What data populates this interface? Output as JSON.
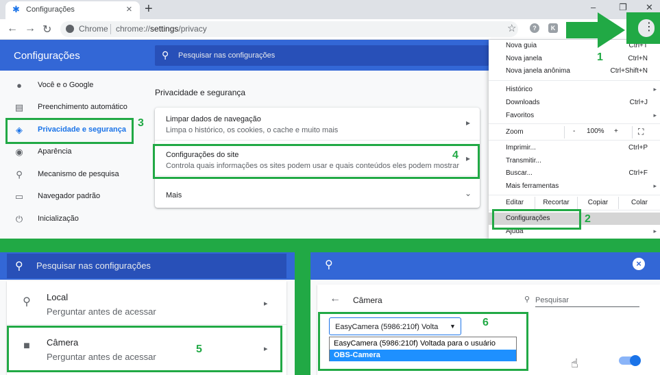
{
  "browser": {
    "tab_title": "Configurações",
    "new_tab": "+",
    "omnibox_scheme": "Chrome",
    "url_prefix": "chrome://",
    "url_host": "settings",
    "url_path": "/privacy",
    "ext_k": "K"
  },
  "settings": {
    "title": "Configurações",
    "search_placeholder": "Pesquisar nas configurações",
    "sidebar": [
      {
        "label": "Você e o Google",
        "icon": "person-icon"
      },
      {
        "label": "Preenchimento automático",
        "icon": "clipboard-icon"
      },
      {
        "label": "Privacidade e segurança",
        "icon": "shield-icon",
        "active": true
      },
      {
        "label": "Aparência",
        "icon": "palette-icon"
      },
      {
        "label": "Mecanismo de pesquisa",
        "icon": "search-icon"
      },
      {
        "label": "Navegador padrão",
        "icon": "browser-icon"
      },
      {
        "label": "Inicialização",
        "icon": "power-icon"
      }
    ],
    "section_title": "Privacidade e segurança",
    "rows": [
      {
        "title": "Limpar dados de navegação",
        "desc": "Limpa o histórico, os cookies, o cache e muito mais"
      },
      {
        "title": "Configurações do site",
        "desc": "Controla quais informações os sites podem usar e quais conteúdos eles podem mostrar"
      },
      {
        "title": "Mais"
      }
    ]
  },
  "menu": {
    "new_tab": {
      "label": "Nova guia",
      "shortcut": "Ctrl+T"
    },
    "new_window": {
      "label": "Nova janela",
      "shortcut": "Ctrl+N"
    },
    "new_incognito": {
      "label": "Nova janela anônima",
      "shortcut": "Ctrl+Shift+N"
    },
    "history": "Histórico",
    "downloads": {
      "label": "Downloads",
      "shortcut": "Ctrl+J"
    },
    "bookmarks": "Favoritos",
    "zoom": {
      "label": "Zoom",
      "minus": "-",
      "value": "100%",
      "plus": "+"
    },
    "print": {
      "label": "Imprimir...",
      "shortcut": "Ctrl+P"
    },
    "cast": "Transmitir...",
    "find": {
      "label": "Buscar...",
      "shortcut": "Ctrl+F"
    },
    "more_tools": "Mais ferramentas",
    "edit": {
      "label": "Editar",
      "cut": "Recortar",
      "copy": "Copiar",
      "paste": "Colar"
    },
    "settings": "Configurações",
    "help": "Ajuda"
  },
  "annotations": [
    "1",
    "2",
    "3",
    "4",
    "5",
    "6"
  ],
  "bottom_left": {
    "search_placeholder": "Pesquisar nas configurações",
    "rows": [
      {
        "title": "Local",
        "desc": "Perguntar antes de acessar"
      },
      {
        "title": "Câmera",
        "desc": "Perguntar antes de acessar"
      }
    ]
  },
  "bottom_right": {
    "title": "Câmera",
    "search_placeholder": "Pesquisar",
    "selected_value": "EasyCamera (5986:210f) Volta",
    "options": [
      "EasyCamera (5986:210f) Voltada para o usuário",
      "OBS-Camera"
    ]
  },
  "colors": {
    "accent": "#1a73e8",
    "header": "#3367d6",
    "annotation": "#21a945"
  }
}
